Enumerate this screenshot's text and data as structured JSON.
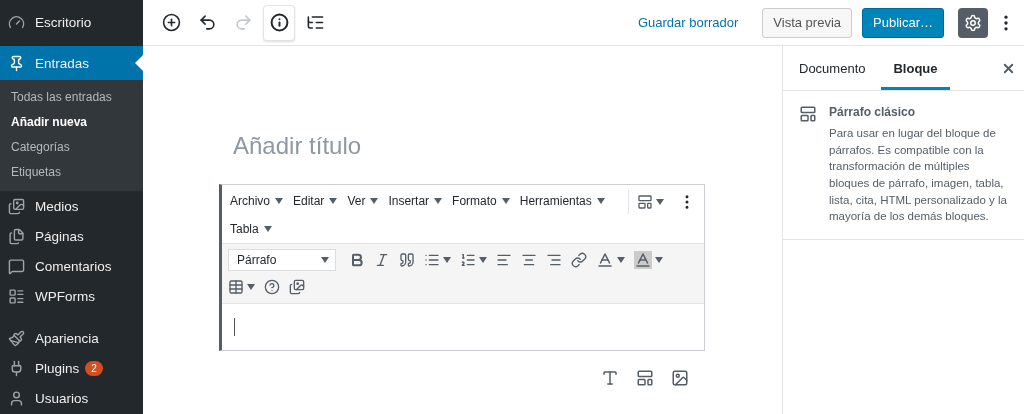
{
  "sidebar": {
    "items": [
      {
        "kind": "dashboard",
        "label": "Escritorio",
        "selected": false
      },
      {
        "kind": "posts",
        "label": "Entradas",
        "selected": true,
        "children": [
          {
            "label": "Todas las entradas",
            "selected": false
          },
          {
            "label": "Añadir nueva",
            "selected": true
          },
          {
            "label": "Categorías",
            "selected": false
          },
          {
            "label": "Etiquetas",
            "selected": false
          }
        ]
      },
      {
        "kind": "media",
        "label": "Medios",
        "selected": false
      },
      {
        "kind": "pages",
        "label": "Páginas",
        "selected": false
      },
      {
        "kind": "comments",
        "label": "Comentarios",
        "selected": false
      },
      {
        "kind": "forms",
        "label": "WPForms",
        "selected": false
      },
      {
        "kind": "appearance",
        "label": "Apariencia",
        "selected": false
      },
      {
        "kind": "plugins",
        "label": "Plugins",
        "selected": false,
        "badge": "2"
      },
      {
        "kind": "users",
        "label": "Usuarios",
        "selected": false
      }
    ]
  },
  "toolbar": {
    "tools": [
      {
        "kind": "add",
        "disabled": false,
        "selected": false
      },
      {
        "kind": "undo",
        "disabled": false,
        "selected": false
      },
      {
        "kind": "redo",
        "disabled": true,
        "selected": false
      },
      {
        "kind": "info",
        "disabled": false,
        "selected": true
      },
      {
        "kind": "outline",
        "disabled": false,
        "selected": false
      }
    ],
    "save_draft": "Guardar borrador",
    "preview": "Vista previa",
    "publish": "Publicar…",
    "settings_selected": true
  },
  "editor": {
    "title_placeholder": "Añadir título",
    "menus": [
      "Archivo",
      "Editar",
      "Ver",
      "Insertar",
      "Formato",
      "Herramientas",
      "Tabla"
    ],
    "format": "Párrafo"
  },
  "panel": {
    "tabs": [
      {
        "label": "Documento",
        "selected": false
      },
      {
        "label": "Bloque",
        "selected": true
      }
    ],
    "block_name": "Párrafo clásico",
    "block_description": "Para usar en lugar del bloque de párrafos. Es compatible con la transformación de múltiples bloques de párrafo, imagen, tabla, lista, cita, HTML personalizado y la mayoría de los demás bloques."
  }
}
